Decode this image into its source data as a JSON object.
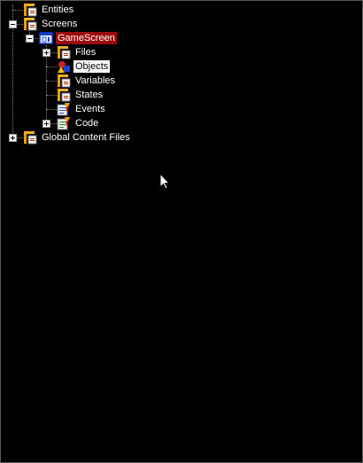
{
  "tree": {
    "items": [
      {
        "label": "Entities",
        "icon": "folder-icon"
      },
      {
        "label": "Screens",
        "icon": "folder-icon"
      },
      {
        "label": "GameScreen",
        "icon": "screen-icon"
      },
      {
        "label": "Files",
        "icon": "folder-icon"
      },
      {
        "label": "Objects",
        "icon": "objects-icon"
      },
      {
        "label": "Variables",
        "icon": "folder-icon"
      },
      {
        "label": "States",
        "icon": "folder-icon"
      },
      {
        "label": "Events",
        "icon": "events-icon"
      },
      {
        "label": "Code",
        "icon": "code-icon"
      },
      {
        "label": "Global Content Files",
        "icon": "folder-icon"
      }
    ]
  },
  "colors": {
    "background": "#000000",
    "selected": "#9b0b0b",
    "hover": "#ffffff",
    "folder": "#e8a000"
  }
}
